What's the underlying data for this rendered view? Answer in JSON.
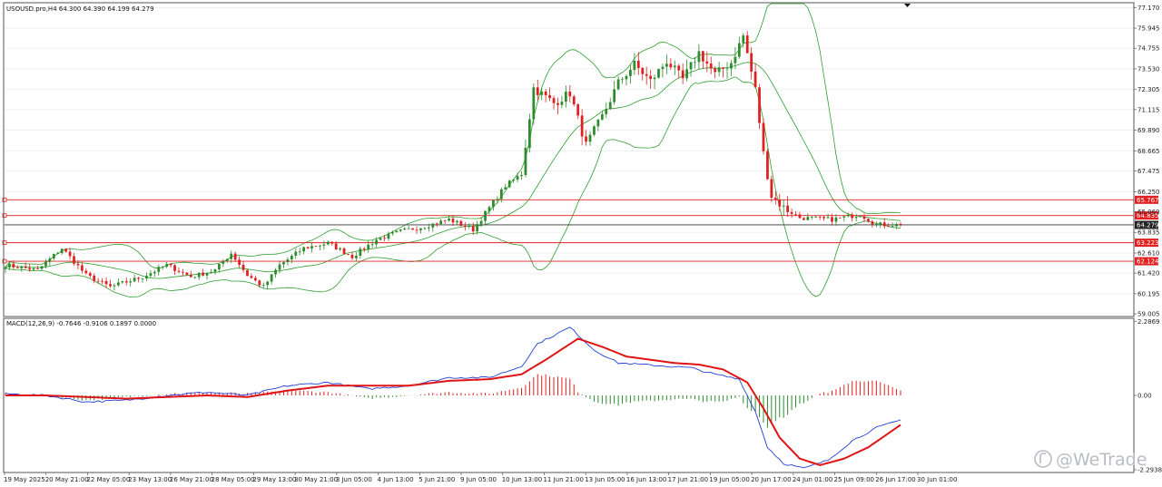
{
  "header": {
    "price_title": "USOUSD.pro,H4  64.300 64.390 64.199 64.279",
    "macd_title": "MACD(12,26,9) -0.7646 -0.9106 0.1897 0.0000"
  },
  "watermark": "@WeTrade",
  "colors": {
    "bull": "#2e8b2e",
    "bear": "#e02020",
    "band": "#2e9e2e",
    "level": "#e02020",
    "macd_line": "#1f3fd8",
    "signal_line": "#e01414",
    "grid": "#e8e8e8"
  },
  "price_axis": {
    "ticks": [
      "77.170",
      "75.945",
      "74.755",
      "73.530",
      "72.305",
      "71.115",
      "69.890",
      "68.665",
      "67.475",
      "66.250",
      "65.060",
      "63.835",
      "62.610",
      "61.420",
      "60.195",
      "59.005"
    ],
    "ylim": [
      58.9,
      77.4
    ]
  },
  "levels": [
    {
      "value": 65.767,
      "label": "65.767",
      "style": "red"
    },
    {
      "value": 64.835,
      "label": "64.835",
      "style": "red"
    },
    {
      "value": 64.279,
      "label": "64.279",
      "style": "current"
    },
    {
      "value": 63.223,
      "label": "63.223",
      "style": "red"
    },
    {
      "value": 62.124,
      "label": "62.124",
      "style": "red"
    }
  ],
  "macd_axis": {
    "ticks": [
      "2.2869",
      "0.00",
      "-2.2938"
    ],
    "ylim": [
      -2.35,
      2.35
    ]
  },
  "time_axis": [
    "19 May 2025",
    "20 May 21:00",
    "22 May 05:00",
    "23 May 13:00",
    "26 May 21:00",
    "28 May 05:00",
    "29 May 13:00",
    "30 May 21:00",
    "3 Jun 05:00",
    "4 Jun 13:00",
    "5 Jun 21:00",
    "9 Jun 05:00",
    "10 Jun 13:00",
    "11 Jun 21:00",
    "13 Jun 05:00",
    "16 Jun 13:00",
    "17 Jun 21:00",
    "19 Jun 05:00",
    "20 Jun 17:00",
    "24 Jun 01:00",
    "25 Jun 09:00",
    "26 Jun 17:00",
    "30 Jun 01:00"
  ],
  "chart_data": {
    "type": "candlestick",
    "note_series": "close anchors sampled along the visible H4 path",
    "close_anchors": [
      [
        0,
        61.9
      ],
      [
        8,
        61.6
      ],
      [
        14,
        62.9
      ],
      [
        20,
        61.3
      ],
      [
        26,
        60.6
      ],
      [
        34,
        61.2
      ],
      [
        40,
        61.9
      ],
      [
        46,
        61.2
      ],
      [
        52,
        61.6
      ],
      [
        56,
        62.6
      ],
      [
        60,
        61.3
      ],
      [
        64,
        60.6
      ],
      [
        68,
        61.9
      ],
      [
        74,
        62.9
      ],
      [
        80,
        63.2
      ],
      [
        86,
        62.4
      ],
      [
        92,
        63.4
      ],
      [
        98,
        63.9
      ],
      [
        104,
        64.2
      ],
      [
        110,
        64.6
      ],
      [
        116,
        64.0
      ],
      [
        120,
        65.3
      ],
      [
        124,
        66.6
      ],
      [
        128,
        67.3
      ],
      [
        131,
        72.4
      ],
      [
        136,
        71.5
      ],
      [
        140,
        72.1
      ],
      [
        144,
        69.0
      ],
      [
        148,
        70.7
      ],
      [
        152,
        72.7
      ],
      [
        156,
        73.8
      ],
      [
        160,
        72.8
      ],
      [
        164,
        74.0
      ],
      [
        168,
        72.9
      ],
      [
        172,
        74.5
      ],
      [
        176,
        73.2
      ],
      [
        180,
        73.9
      ],
      [
        183,
        75.5
      ],
      [
        186,
        72.3
      ],
      [
        188,
        68.5
      ],
      [
        190,
        66.0
      ],
      [
        193,
        65.3
      ],
      [
        197,
        64.7
      ],
      [
        205,
        64.6
      ],
      [
        212,
        64.9
      ],
      [
        216,
        64.3
      ],
      [
        222,
        64.28
      ]
    ],
    "macd_main_anchors": [
      [
        0,
        0.05
      ],
      [
        10,
        0.0
      ],
      [
        20,
        -0.2
      ],
      [
        30,
        -0.15
      ],
      [
        40,
        0.0
      ],
      [
        50,
        0.1
      ],
      [
        60,
        0.0
      ],
      [
        70,
        0.3
      ],
      [
        80,
        0.4
      ],
      [
        90,
        0.2
      ],
      [
        100,
        0.3
      ],
      [
        110,
        0.55
      ],
      [
        120,
        0.55
      ],
      [
        128,
        0.9
      ],
      [
        132,
        1.6
      ],
      [
        140,
        2.1
      ],
      [
        146,
        1.4
      ],
      [
        152,
        1.0
      ],
      [
        158,
        0.95
      ],
      [
        164,
        0.9
      ],
      [
        170,
        0.85
      ],
      [
        176,
        0.65
      ],
      [
        182,
        0.5
      ],
      [
        186,
        -0.5
      ],
      [
        189,
        -1.6
      ],
      [
        193,
        -2.1
      ],
      [
        198,
        -2.25
      ],
      [
        204,
        -2.0
      ],
      [
        210,
        -1.4
      ],
      [
        216,
        -1.0
      ],
      [
        222,
        -0.76
      ]
    ],
    "macd_signal_anchors": [
      [
        0,
        0.0
      ],
      [
        10,
        0.0
      ],
      [
        20,
        -0.05
      ],
      [
        30,
        -0.1
      ],
      [
        40,
        -0.05
      ],
      [
        50,
        0.0
      ],
      [
        60,
        -0.05
      ],
      [
        70,
        0.15
      ],
      [
        80,
        0.3
      ],
      [
        90,
        0.3
      ],
      [
        100,
        0.3
      ],
      [
        110,
        0.45
      ],
      [
        120,
        0.5
      ],
      [
        128,
        0.65
      ],
      [
        134,
        1.1
      ],
      [
        142,
        1.75
      ],
      [
        148,
        1.5
      ],
      [
        154,
        1.2
      ],
      [
        160,
        1.1
      ],
      [
        166,
        1.0
      ],
      [
        172,
        0.95
      ],
      [
        178,
        0.8
      ],
      [
        184,
        0.4
      ],
      [
        188,
        -0.4
      ],
      [
        192,
        -1.3
      ],
      [
        197,
        -1.95
      ],
      [
        202,
        -2.15
      ],
      [
        208,
        -1.95
      ],
      [
        214,
        -1.6
      ],
      [
        222,
        -0.91
      ]
    ],
    "bars": 223
  }
}
